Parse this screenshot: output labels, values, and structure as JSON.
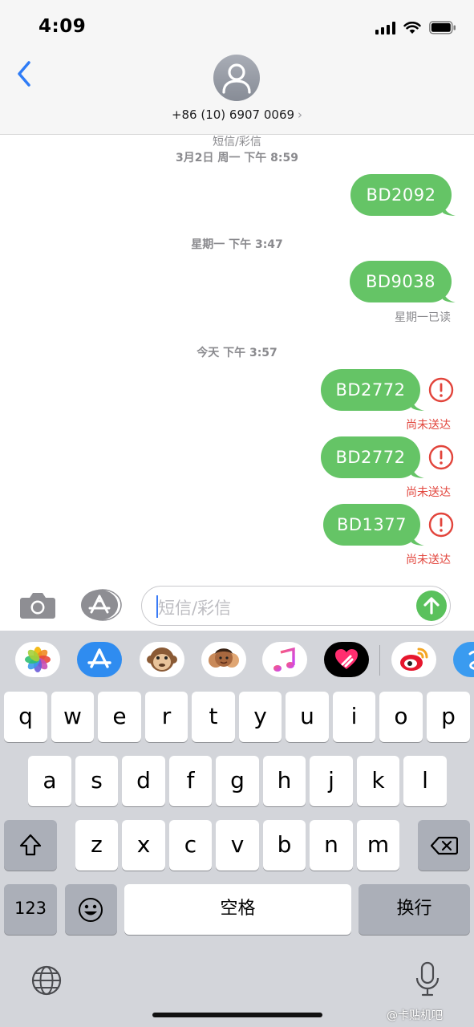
{
  "status_bar": {
    "time": "4:09"
  },
  "header": {
    "contact": "+86 (10) 6907 0069",
    "chevron": "›",
    "icons": [
      "back-chevron-icon",
      "avatar-person-icon"
    ]
  },
  "conversation": {
    "header_label": "短信/彩信",
    "first_timestamp": "3月2日 周一 下午 8:59",
    "messages": [
      {
        "timestamp": "",
        "text": "BD2092",
        "status": ""
      },
      {
        "timestamp": "星期一 下午 3:47",
        "text": "BD9038",
        "status": "星期一已读"
      },
      {
        "timestamp": "今天 下午 3:57",
        "text": "BD2772",
        "status": "尚未送达"
      },
      {
        "timestamp": "",
        "text": "BD2772",
        "status": "尚未送达"
      },
      {
        "timestamp": "",
        "text": "BD1377",
        "status": "尚未送达"
      }
    ],
    "colors": {
      "bubble": "#65c466",
      "error": "#e2453c"
    }
  },
  "input_bar": {
    "placeholder": "短信/彩信",
    "icons": [
      "camera-icon",
      "appstore-icon",
      "send-arrow-icon"
    ]
  },
  "app_strip": {
    "apps": [
      "photos-app-icon",
      "appstore-app-icon",
      "animoji-monkey-icon",
      "memoji-icon",
      "music-app-icon",
      "digital-touch-icon",
      "weibo-app-icon",
      "partial-app-icon"
    ]
  },
  "keyboard": {
    "row1": [
      "q",
      "w",
      "e",
      "r",
      "t",
      "y",
      "u",
      "i",
      "o",
      "p"
    ],
    "row2": [
      "a",
      "s",
      "d",
      "f",
      "g",
      "h",
      "j",
      "k",
      "l"
    ],
    "row3": [
      "z",
      "x",
      "c",
      "v",
      "b",
      "n",
      "m"
    ],
    "numbers_key": "123",
    "space_key": "空格",
    "return_key": "换行",
    "icons": [
      "shift-icon",
      "backspace-icon",
      "emoji-icon",
      "globe-icon",
      "microphone-icon"
    ]
  },
  "watermark": "@卡贴机吧"
}
